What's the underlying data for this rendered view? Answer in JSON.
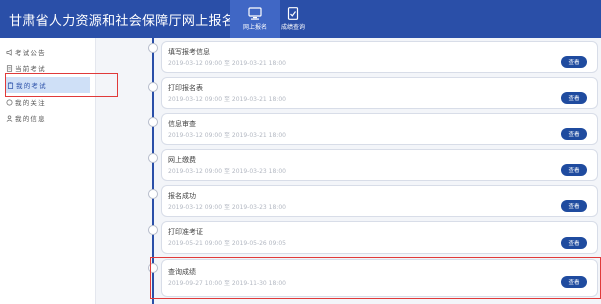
{
  "header": {
    "site_title": "甘肃省人力资源和社会保障厅网上报名系统",
    "tabs": [
      {
        "label": "网上报名",
        "icon": "monitor-icon",
        "active": true
      },
      {
        "label": "成绩查询",
        "icon": "document-check-icon",
        "active": false
      }
    ]
  },
  "sidebar": {
    "items": [
      {
        "label": "考试公告",
        "icon": "megaphone-icon",
        "active": false
      },
      {
        "label": "当前考试",
        "icon": "document-icon",
        "active": false
      },
      {
        "label": "我的考试",
        "icon": "clipboard-icon",
        "active": true
      },
      {
        "label": "我的关注",
        "icon": "heart-icon",
        "active": false
      },
      {
        "label": "我的信息",
        "icon": "person-icon",
        "active": false
      }
    ]
  },
  "timeline": {
    "button_label": "查看",
    "steps": [
      {
        "title": "填写报考信息",
        "time": "2019-03-12 09:00 至 2019-03-21 18:00"
      },
      {
        "title": "打印报名表",
        "time": "2019-03-12 09:00 至 2019-03-21 18:00"
      },
      {
        "title": "信息审查",
        "time": "2019-03-12 09:00 至 2019-03-21 18:00"
      },
      {
        "title": "网上缴费",
        "time": "2019-03-12 09:00 至 2019-03-23 18:00"
      },
      {
        "title": "报名成功",
        "time": "2019-03-12 09:00 至 2019-03-23 18:00"
      },
      {
        "title": "打印准考证",
        "time": "2019-05-21 09:00 至 2019-05-26 09:05"
      },
      {
        "title": "查询成绩",
        "time": "2019-09-27 10:00 至 2019-11-30 18:00"
      }
    ]
  },
  "colors": {
    "header_bg": "#2a4fa8",
    "active_tab_bg": "#4067c5",
    "button_bg": "#1f4b9f",
    "highlight": "#e03a3a"
  }
}
